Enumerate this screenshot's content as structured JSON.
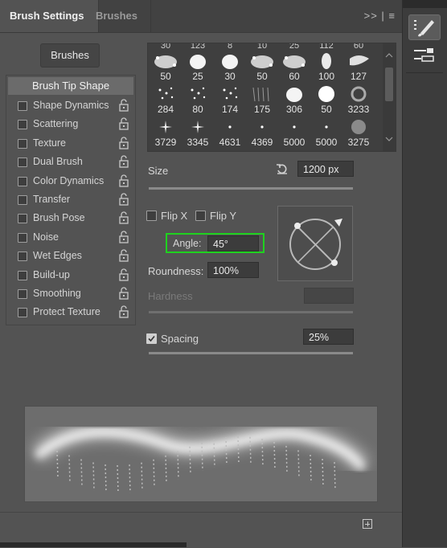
{
  "tabs": {
    "brush_settings": "Brush Settings",
    "brushes": "Brushes",
    "menu_glyph": ">> | ≡"
  },
  "brushes_button": "Brushes",
  "options": {
    "header": "Brush Tip Shape",
    "items": [
      {
        "label": "Shape Dynamics",
        "checked": false,
        "locked": false
      },
      {
        "label": "Scattering",
        "checked": false,
        "locked": false
      },
      {
        "label": "Texture",
        "checked": false,
        "locked": false
      },
      {
        "label": "Dual Brush",
        "checked": false,
        "locked": false
      },
      {
        "label": "Color Dynamics",
        "checked": false,
        "locked": false
      },
      {
        "label": "Transfer",
        "checked": false,
        "locked": false
      },
      {
        "label": "Brush Pose",
        "checked": false,
        "locked": false
      },
      {
        "label": "Noise",
        "checked": false,
        "locked": false
      },
      {
        "label": "Wet Edges",
        "checked": false,
        "locked": false
      },
      {
        "label": "Build-up",
        "checked": false,
        "locked": false
      },
      {
        "label": "Smoothing",
        "checked": false,
        "locked": false
      },
      {
        "label": "Protect Texture",
        "checked": false,
        "locked": false
      }
    ]
  },
  "brush_grid": {
    "partial_top_row": [
      "30",
      "123",
      "8",
      "10",
      "25",
      "112",
      "60"
    ],
    "rows": [
      [
        "50",
        "25",
        "30",
        "50",
        "60",
        "100",
        "127"
      ],
      [
        "284",
        "80",
        "174",
        "175",
        "306",
        "50",
        "3233"
      ],
      [
        "3729",
        "3345",
        "4631",
        "4369",
        "5000",
        "5000",
        "3275"
      ]
    ]
  },
  "size": {
    "label": "Size",
    "value": "1200 px",
    "slider_fraction": 0.92
  },
  "flip": {
    "flip_x": "Flip X",
    "flip_y": "Flip Y",
    "flip_x_checked": false,
    "flip_y_checked": false
  },
  "angle": {
    "label": "Angle:",
    "value": "45°"
  },
  "roundness": {
    "label": "Roundness:",
    "value": "100%"
  },
  "hardness": {
    "label": "Hardness",
    "value": ""
  },
  "spacing": {
    "label": "Spacing",
    "value": "25%",
    "checked": true,
    "slider_fraction": 0.12
  },
  "colors": {
    "highlight": "#1fd21f",
    "panel": "#535353",
    "tabbar": "#424242"
  }
}
